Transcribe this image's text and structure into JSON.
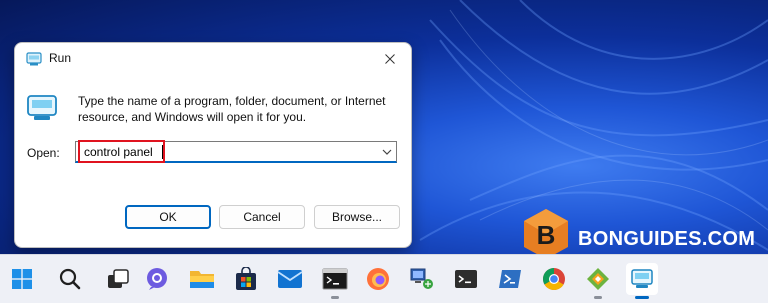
{
  "dialog": {
    "title": "Run",
    "description": "Type the name of a program, folder, document, or Internet resource, and Windows will open it for you.",
    "open_label": "Open:",
    "open_value": "control panel",
    "buttons": {
      "ok": "OK",
      "cancel": "Cancel",
      "browse": "Browse..."
    }
  },
  "watermark": {
    "text": "BONGUIDES.COM",
    "letter": "B"
  },
  "taskbar": {
    "icons": [
      "windows-start-icon",
      "search-icon",
      "task-view-icon",
      "teams-chat-icon",
      "file-explorer-icon",
      "microsoft-store-icon",
      "mail-icon",
      "command-prompt-icon",
      "firefox-icon",
      "network-icon",
      "terminal-icon",
      "powershell-icon",
      "chrome-icon",
      "vmware-icon",
      "run-icon"
    ]
  },
  "colors": {
    "accent": "#0067c0",
    "highlight": "#e0131f",
    "brand": "#e67e22"
  }
}
